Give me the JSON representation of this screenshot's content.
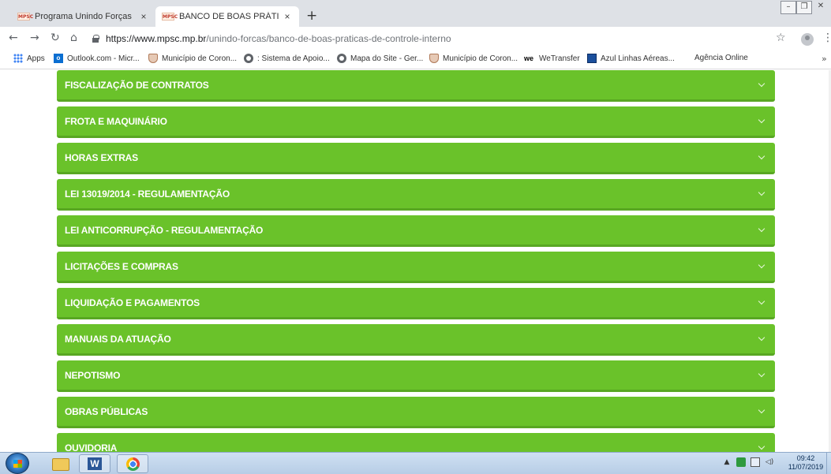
{
  "browser": {
    "tabs": [
      {
        "favicon": "MPSC",
        "title": "Programa Unindo Forças",
        "close": "×"
      },
      {
        "favicon": "MPSC",
        "title": "BANCO DE BOAS PRÁTICAS DE C",
        "close": "×"
      }
    ],
    "new_tab": "+",
    "url_host": "https://www.mpsc.mp.br",
    "url_path": "/unindo-forcas/banco-de-boas-praticas-de-controle-interno"
  },
  "bookmarks": [
    {
      "icon": "apps-grid-icon",
      "label": "Apps"
    },
    {
      "icon": "outlook-icon",
      "label": "Outlook.com - Micr..."
    },
    {
      "icon": "municipality-crest-icon",
      "label": "Município de Coron..."
    },
    {
      "icon": "globe-icon",
      "label": ": Sistema de Apoio..."
    },
    {
      "icon": "globe-icon",
      "label": "Mapa do Site - Ger..."
    },
    {
      "icon": "municipality-crest-icon",
      "label": "Município de Coron..."
    },
    {
      "icon": "wetransfer-icon",
      "label": "WeTransfer"
    },
    {
      "icon": "azul-icon",
      "label": "Azul Linhas Aéreas..."
    },
    {
      "icon": "none",
      "label": "Agência Online"
    }
  ],
  "accordion": [
    "FISCALIZAÇÃO DE CONTRATOS",
    "FROTA E MAQUINÁRIO",
    "HORAS EXTRAS",
    "LEI 13019/2014 - REGULAMENTAÇÃO",
    "LEI ANTICORRUPÇÃO - REGULAMENTAÇÃO",
    "LICITAÇÕES E COMPRAS",
    "LIQUIDAÇÃO E PAGAMENTOS",
    "MANUAIS DA ATUAÇÃO",
    "NEPOTISMO",
    "OBRAS PÚBLICAS",
    "OUVIDORIA"
  ],
  "colors": {
    "accordion_green": "#6ac22a",
    "accordion_border": "#58a722"
  },
  "taskbar": {
    "time": "09:42",
    "date": "11/07/2019",
    "apps": [
      "windows-explorer-icon",
      "word-icon",
      "chrome-icon"
    ]
  }
}
